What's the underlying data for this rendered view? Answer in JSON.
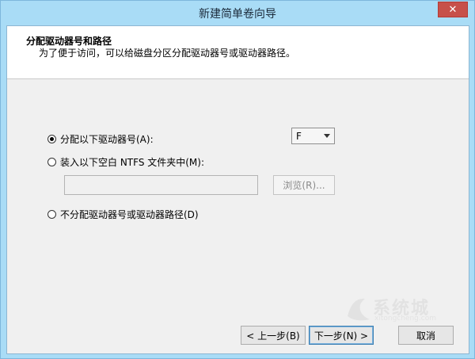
{
  "window": {
    "title": "新建简单卷向导",
    "close_label": "✕"
  },
  "header": {
    "title": "分配驱动器号和路径",
    "subtitle": "为了便于访问，可以给磁盘分区分配驱动器号或驱动器路径。"
  },
  "options": {
    "assign_letter": {
      "label": "分配以下驱动器号(A):",
      "selected": true
    },
    "mount_folder": {
      "label": "装入以下空白 NTFS 文件夹中(M):",
      "selected": false
    },
    "no_assign": {
      "label": "不分配驱动器号或驱动器路径(D)",
      "selected": false
    }
  },
  "drive_select": {
    "value": "F"
  },
  "path_input": {
    "value": ""
  },
  "browse_button": {
    "label": "浏览(R)..."
  },
  "buttons": {
    "back": "< 上一步(B)",
    "next": "下一步(N) >",
    "cancel": "取消"
  },
  "watermark": {
    "text": "系统城",
    "url": "xitongcheng.com"
  }
}
